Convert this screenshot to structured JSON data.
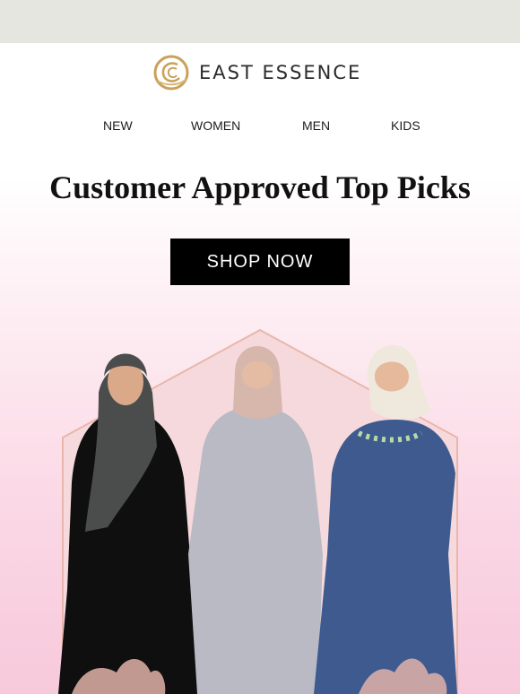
{
  "brand": {
    "name": "EAST ESSENCE",
    "accent_color": "#c9a15a"
  },
  "nav": {
    "items": [
      {
        "label": "NEW"
      },
      {
        "label": "WOMEN"
      },
      {
        "label": "MEN"
      },
      {
        "label": "KIDS"
      }
    ]
  },
  "hero": {
    "headline": "Customer Approved Top Picks",
    "cta_label": "SHOP NOW",
    "models": [
      {
        "dress_color": "#0f0f10",
        "hijab_color": "#4a4d4c"
      },
      {
        "dress_color": "#b9bac4",
        "hijab_color": "#d7b7ac"
      },
      {
        "dress_color": "#3e5a8f",
        "hijab_color": "#efe8dc"
      }
    ]
  }
}
